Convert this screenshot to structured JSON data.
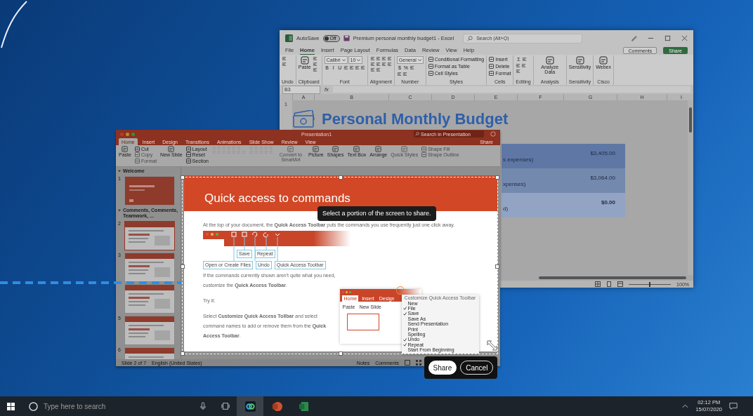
{
  "excel": {
    "autosave": {
      "label": "AutoSave",
      "state": "Off",
      "on": false
    },
    "title": "Premium personal monthly budget1  -  Excel",
    "search": {
      "placeholder": "Search (Alt+Q)"
    },
    "tabs": [
      {
        "label": "File",
        "selected": false
      },
      {
        "label": "Home",
        "selected": true
      },
      {
        "label": "Insert",
        "selected": false
      },
      {
        "label": "Page Layout",
        "selected": false
      },
      {
        "label": "Formulas",
        "selected": false
      },
      {
        "label": "Data",
        "selected": false
      },
      {
        "label": "Review",
        "selected": false
      },
      {
        "label": "View",
        "selected": false
      },
      {
        "label": "Help",
        "selected": false
      }
    ],
    "comments_button": "Comments",
    "share_button": "Share",
    "ribbon_groups": [
      {
        "label": "Undo",
        "columns": [
          {
            "items": [
              {
                "kind": "icon"
              },
              {
                "kind": "icon"
              }
            ]
          }
        ]
      },
      {
        "label": "Clipboard",
        "columns": [
          {
            "items": [
              {
                "kind": "large",
                "label": "Paste"
              }
            ]
          },
          {
            "items": [
              {
                "kind": "icon"
              },
              {
                "kind": "icon"
              },
              {
                "kind": "icon"
              }
            ]
          }
        ]
      },
      {
        "label": "Font",
        "columns": [
          {
            "items": [
              {
                "kind": "row",
                "items": [
                  {
                    "kind": "field",
                    "label": "Calibri"
                  },
                  {
                    "kind": "field",
                    "label": "10"
                  }
                ]
              },
              {
                "kind": "row",
                "items": [
                  {
                    "kind": "glyph",
                    "label": "B"
                  },
                  {
                    "kind": "glyph",
                    "label": "I"
                  },
                  {
                    "kind": "glyph",
                    "label": "U"
                  },
                  {
                    "kind": "icon"
                  },
                  {
                    "kind": "icon"
                  },
                  {
                    "kind": "icon"
                  },
                  {
                    "kind": "icon"
                  }
                ]
              }
            ]
          }
        ]
      },
      {
        "label": "Alignment",
        "columns": [
          {
            "items": [
              {
                "kind": "row",
                "items": [
                  {
                    "kind": "icon"
                  },
                  {
                    "kind": "icon"
                  },
                  {
                    "kind": "icon"
                  },
                  {
                    "kind": "icon"
                  }
                ]
              },
              {
                "kind": "row",
                "items": [
                  {
                    "kind": "icon"
                  },
                  {
                    "kind": "icon"
                  },
                  {
                    "kind": "icon"
                  },
                  {
                    "kind": "icon"
                  }
                ]
              },
              {
                "kind": "row",
                "items": [
                  {
                    "kind": "icon"
                  },
                  {
                    "kind": "icon"
                  }
                ]
              }
            ]
          }
        ]
      },
      {
        "label": "Number",
        "columns": [
          {
            "items": [
              {
                "kind": "field",
                "label": "General"
              },
              {
                "kind": "row",
                "items": [
                  {
                    "kind": "glyph",
                    "label": "$"
                  },
                  {
                    "kind": "glyph",
                    "label": "%"
                  },
                  {
                    "kind": "icon"
                  }
                ]
              },
              {
                "kind": "row",
                "items": [
                  {
                    "kind": "icon"
                  },
                  {
                    "kind": "icon"
                  }
                ]
              }
            ]
          }
        ]
      },
      {
        "label": "Styles",
        "columns": [
          {
            "items": [
              {
                "kind": "small",
                "label": "Conditional Formatting"
              },
              {
                "kind": "small",
                "label": "Format as Table"
              },
              {
                "kind": "small",
                "label": "Cell Styles"
              }
            ]
          }
        ]
      },
      {
        "label": "Cells",
        "columns": [
          {
            "items": [
              {
                "kind": "small",
                "label": "Insert"
              },
              {
                "kind": "small",
                "label": "Delete"
              },
              {
                "kind": "small",
                "label": "Format"
              }
            ]
          }
        ]
      },
      {
        "label": "Editing",
        "columns": [
          {
            "items": [
              {
                "kind": "row",
                "items": [
                  {
                    "kind": "glyph",
                    "label": "Σ"
                  },
                  {
                    "kind": "icon"
                  }
                ]
              },
              {
                "kind": "row",
                "items": [
                  {
                    "kind": "icon"
                  },
                  {
                    "kind": "icon"
                  }
                ]
              },
              {
                "kind": "row",
                "items": [
                  {
                    "kind": "icon"
                  }
                ]
              }
            ]
          }
        ]
      },
      {
        "label": "Analysis",
        "columns": [
          {
            "items": [
              {
                "kind": "large",
                "label": "Analyze Data"
              }
            ]
          }
        ]
      },
      {
        "label": "Sensitivity",
        "columns": [
          {
            "items": [
              {
                "kind": "large",
                "label": "Sensitivity"
              }
            ]
          }
        ]
      },
      {
        "label": "Cisco",
        "columns": [
          {
            "items": [
              {
                "kind": "large",
                "label": "Webex"
              }
            ]
          }
        ]
      }
    ],
    "name_box": "B3",
    "formula_label": "fx",
    "columns": [
      "A",
      "B",
      "C",
      "D",
      "E",
      "F",
      "G",
      "H",
      "I"
    ],
    "row_headers": [
      "1"
    ],
    "sheet_title": "Personal Monthly Budget",
    "budget_rows": [
      {
        "label": "s expenses)",
        "amount": "$3,405.00",
        "bold": false
      },
      {
        "label": "xpenses)",
        "amount": "$3,064.00",
        "bold": false
      },
      {
        "label": "d)",
        "amount": "$0.00",
        "bold": true
      }
    ],
    "zoom_slider": {
      "level": 0.5
    },
    "zoom": "100%"
  },
  "powerpoint": {
    "title": "Presentation1",
    "search": {
      "placeholder": "Search in Presentation"
    },
    "tabs": [
      {
        "label": "Home",
        "selected": true
      },
      {
        "label": "Insert",
        "selected": false
      },
      {
        "label": "Design",
        "selected": false
      },
      {
        "label": "Transitions",
        "selected": false
      },
      {
        "label": "Animations",
        "selected": false
      },
      {
        "label": "Slide Show",
        "selected": false
      },
      {
        "label": "Review",
        "selected": false
      },
      {
        "label": "View",
        "selected": false
      }
    ],
    "share_button": "Share",
    "ribbon": [
      {
        "items": [
          {
            "kind": "large",
            "label": "Paste",
            "disabled": false
          }
        ]
      },
      {
        "items": [
          {
            "kind": "small",
            "label": "Cut",
            "disabled": false
          },
          {
            "kind": "small",
            "label": "Copy",
            "disabled": true
          },
          {
            "kind": "small",
            "label": "Format",
            "disabled": true
          }
        ]
      },
      {
        "items": [
          {
            "kind": "large",
            "label": "New Slide",
            "disabled": false
          }
        ]
      },
      {
        "items": [
          {
            "kind": "small",
            "label": "Layout",
            "disabled": false
          },
          {
            "kind": "small",
            "label": "Reset",
            "disabled": false
          },
          {
            "kind": "small",
            "label": "Section",
            "disabled": false
          }
        ]
      },
      {
        "items": [
          {
            "kind": "row",
            "items": [
              {
                "kind": "icon",
                "disabled": true
              },
              {
                "kind": "icon",
                "disabled": true
              },
              {
                "kind": "icon",
                "disabled": true
              },
              {
                "kind": "icon",
                "disabled": true
              },
              {
                "kind": "icon",
                "disabled": true
              },
              {
                "kind": "icon",
                "disabled": true
              }
            ]
          },
          {
            "kind": "row",
            "items": [
              {
                "kind": "icon",
                "disabled": true
              },
              {
                "kind": "icon",
                "disabled": true
              },
              {
                "kind": "icon",
                "disabled": true
              },
              {
                "kind": "icon",
                "disabled": true
              },
              {
                "kind": "icon",
                "disabled": true
              },
              {
                "kind": "icon",
                "disabled": true
              },
              {
                "kind": "icon",
                "disabled": true
              }
            ]
          }
        ]
      },
      {
        "items": [
          {
            "kind": "row",
            "items": [
              {
                "kind": "icon",
                "disabled": true
              },
              {
                "kind": "icon",
                "disabled": true
              },
              {
                "kind": "icon",
                "disabled": true
              },
              {
                "kind": "icon",
                "disabled": true
              },
              {
                "kind": "icon",
                "disabled": true
              }
            ]
          },
          {
            "kind": "row",
            "items": [
              {
                "kind": "icon",
                "disabled": true
              },
              {
                "kind": "icon",
                "disabled": true
              },
              {
                "kind": "icon",
                "disabled": true
              },
              {
                "kind": "icon",
                "disabled": true
              },
              {
                "kind": "icon",
                "disabled": true
              }
            ]
          }
        ]
      },
      {
        "items": [
          {
            "kind": "large",
            "label": "Convert to SmartArt",
            "disabled": true
          }
        ]
      },
      {
        "items": [
          {
            "kind": "large",
            "label": "Picture",
            "disabled": false
          }
        ]
      },
      {
        "items": [
          {
            "kind": "large",
            "label": "Shapes",
            "disabled": false
          }
        ]
      },
      {
        "items": [
          {
            "kind": "large",
            "label": "Text Box",
            "disabled": false
          }
        ]
      },
      {
        "items": [
          {
            "kind": "large",
            "label": "Arrange",
            "disabled": false
          }
        ]
      },
      {
        "items": [
          {
            "kind": "large",
            "label": "Quick Styles",
            "disabled": true
          }
        ]
      },
      {
        "items": [
          {
            "kind": "small",
            "label": "Shape Fill",
            "disabled": true
          },
          {
            "kind": "small",
            "label": "Shape Outline",
            "disabled": true
          }
        ]
      }
    ],
    "sections": [
      {
        "title": "Welcome",
        "expanded": true,
        "slides": [
          {
            "number": "1",
            "kind": "title",
            "selected": false
          }
        ]
      },
      {
        "title": "Comments, Comments, Teamwork, ...",
        "expanded": true,
        "slides": [
          {
            "number": "2",
            "kind": "content",
            "selected": true
          },
          {
            "number": "3",
            "kind": "content",
            "selected": false
          },
          {
            "kind": "content",
            "selected": false
          },
          {
            "number": "5",
            "kind": "content",
            "selected": false
          },
          {
            "number": "6",
            "kind": "content",
            "selected": false
          }
        ]
      }
    ],
    "status": {
      "slide": "Slide 2 of 7",
      "language": "English (United States)",
      "notes": "Notes",
      "comments": "Comments"
    }
  },
  "slide": {
    "title": "Quick access to commands",
    "intro": "At the top of your document, the **Quick Access Toolbar** puts the commands you use frequently just one click away.",
    "callouts_top": [
      "Save",
      "Repeat"
    ],
    "callouts_bottom": [
      "Open or Create Files",
      "Undo",
      "Quick Access Toolbar"
    ],
    "paragraphs": [
      "If the commands currently shown aren't quite what you need, customize the **Quick Access Toolbar**.",
      "Try it:",
      "Select **Customize Quick Access Tollbar** and select command names to add or remove them from the **Quick Access Toolbar**."
    ],
    "mini_tabs": [
      {
        "label": "Home",
        "selected": true
      },
      {
        "label": "Insert",
        "selected": false
      },
      {
        "label": "Design",
        "selected": false
      }
    ],
    "mini_buttons": [
      "Paste",
      "New Slide"
    ],
    "menu": {
      "title": "Customize Quick Access Toolbar",
      "items": [
        {
          "label": "New",
          "checked": false
        },
        {
          "label": "File",
          "checked": true
        },
        {
          "label": "Save",
          "checked": true
        },
        {
          "label": "Save As",
          "checked": false
        },
        {
          "label": "Send Presentation",
          "checked": false
        },
        {
          "label": "Print",
          "checked": false
        },
        {
          "label": "Spelling",
          "checked": false
        },
        {
          "label": "Undo",
          "checked": true
        },
        {
          "label": "Repeat",
          "checked": true
        },
        {
          "label": "Start From Beginning",
          "checked": false
        }
      ]
    }
  },
  "tooltip": "Select a portion of the screen to share.",
  "share_panel": {
    "share": "Share",
    "cancel": "Cancel"
  },
  "taskbar": {
    "search": {
      "placeholder": "Type here to search"
    },
    "apps": [
      {
        "kind": "webex",
        "active": true
      },
      {
        "kind": "powerpoint",
        "active": false
      },
      {
        "kind": "excel",
        "active": false
      }
    ],
    "time": "02:12 PM",
    "date": "15/07/2020"
  }
}
